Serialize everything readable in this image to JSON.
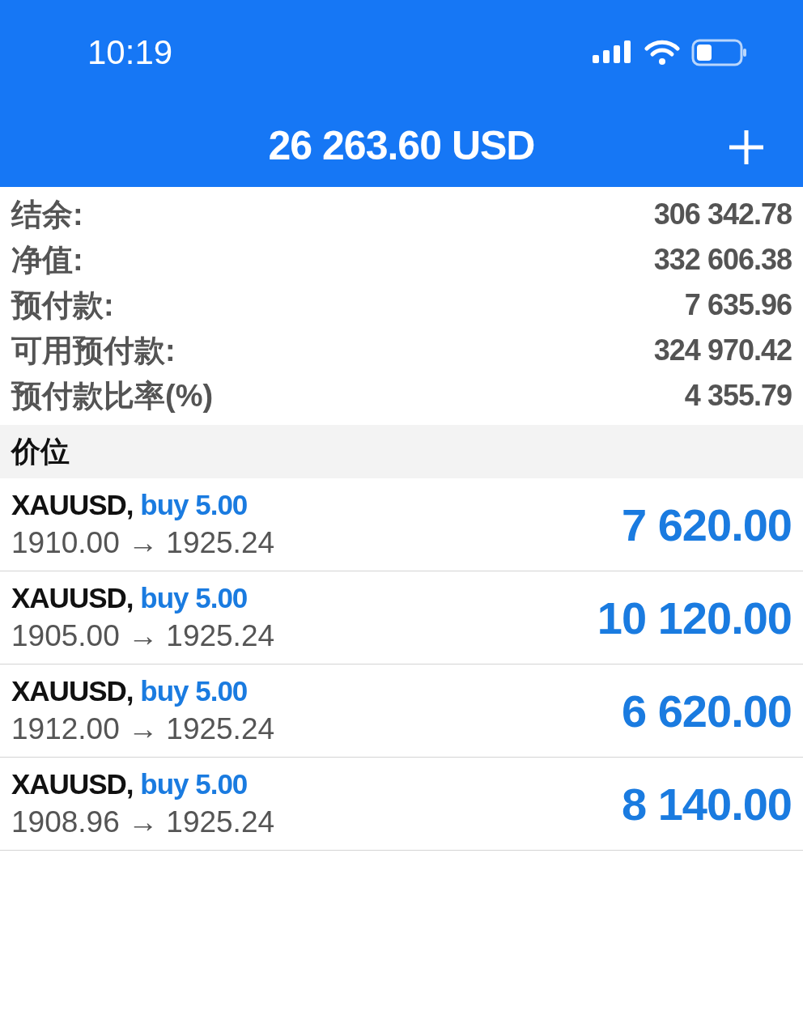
{
  "status_bar": {
    "time": "10:19"
  },
  "header": {
    "title": "26 263.60 USD"
  },
  "account": [
    {
      "label": "结余:",
      "value": "306 342.78"
    },
    {
      "label": "净值:",
      "value": "332 606.38"
    },
    {
      "label": "预付款:",
      "value": "7 635.96"
    },
    {
      "label": "可用预付款:",
      "value": "324 970.42"
    },
    {
      "label": "预付款比率(%)",
      "value": "4 355.79"
    }
  ],
  "section_title": "价位",
  "positions": [
    {
      "symbol": "XAUUSD,",
      "kind": "buy",
      "side": "buy 5.00",
      "prices": "1910.00 → 1925.24",
      "profit": "7 620.00"
    },
    {
      "symbol": "XAUUSD,",
      "kind": "buy",
      "side": "buy 5.00",
      "prices": "1905.00 → 1925.24",
      "profit": "10 120.00"
    },
    {
      "symbol": "XAUUSD,",
      "kind": "buy",
      "side": "buy 5.00",
      "prices": "1912.00 → 1925.24",
      "profit": "6 620.00"
    },
    {
      "symbol": "XAUUSD,",
      "kind": "buy",
      "side": "buy 5.00",
      "prices": "1908.96 → 1925.24",
      "profit": "8 140.00"
    }
  ]
}
